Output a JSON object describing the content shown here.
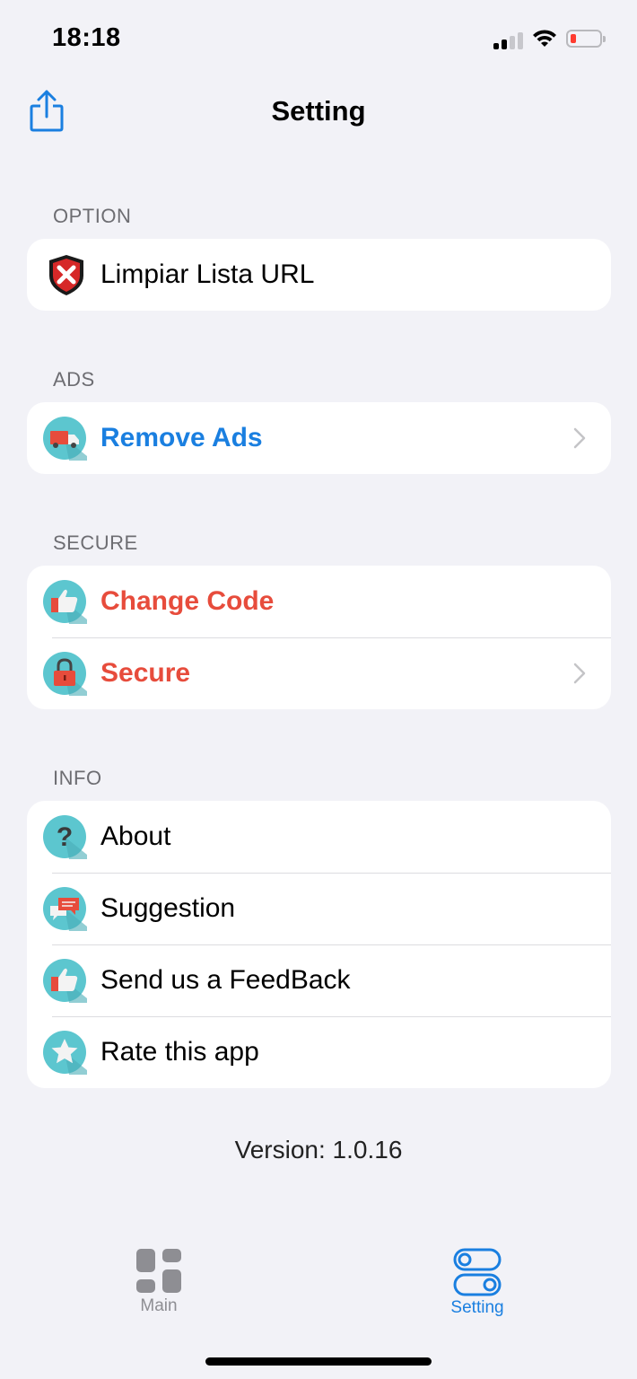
{
  "status": {
    "time": "18:18"
  },
  "nav": {
    "title": "Setting"
  },
  "sections": {
    "option": {
      "header": "OPTION",
      "items": [
        {
          "label": "Limpiar Lista URL"
        }
      ]
    },
    "ads": {
      "header": "ADS",
      "items": [
        {
          "label": "Remove Ads"
        }
      ]
    },
    "secure": {
      "header": "SECURE",
      "items": [
        {
          "label": "Change Code"
        },
        {
          "label": "Secure"
        }
      ]
    },
    "info": {
      "header": "INFO",
      "items": [
        {
          "label": "About"
        },
        {
          "label": "Suggestion"
        },
        {
          "label": "Send us a FeedBack"
        },
        {
          "label": "Rate this app"
        }
      ]
    }
  },
  "version": "Version: 1.0.16",
  "tabbar": {
    "items": [
      {
        "label": "Main"
      },
      {
        "label": "Setting"
      }
    ]
  },
  "colors": {
    "accent": "#1a7fe0",
    "danger": "#e74c3c",
    "icon_bg": "#5cc6cf",
    "background": "#f2f2f7"
  }
}
